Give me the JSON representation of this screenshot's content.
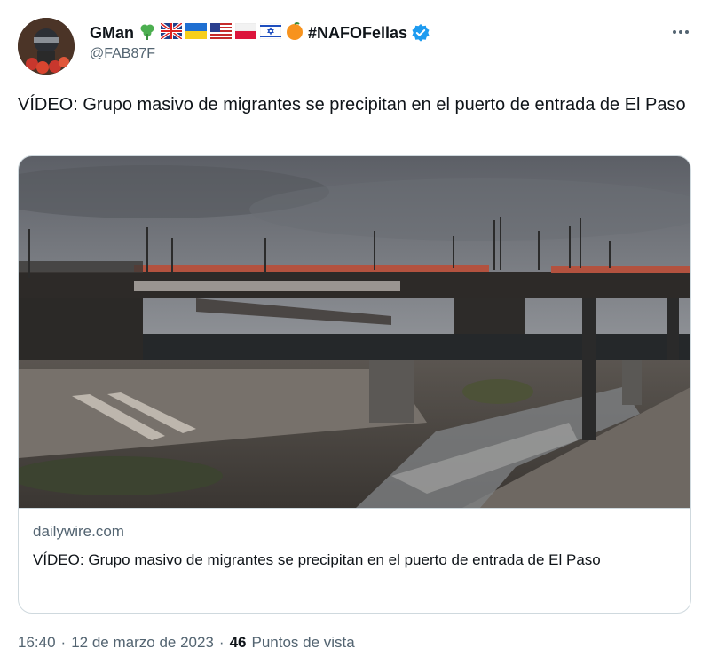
{
  "author": {
    "display_name": "GMan",
    "name_emojis": [
      "☘️",
      "🇬🇧",
      "🇺🇦",
      "🇺🇸",
      "🇵🇱",
      "🇮🇱",
      "🍊"
    ],
    "name_tag": "#NAFOFellas",
    "handle": "@FAB87F",
    "verified": true
  },
  "tweet": {
    "text": "VÍDEO: Grupo masivo de migrantes se precipitan en el puerto de entrada de El Paso"
  },
  "card": {
    "domain": "dailywire.com",
    "title": "VÍDEO: Grupo masivo de migrantes se precipitan en el puerto de entrada de El Paso"
  },
  "meta": {
    "time": "16:40",
    "date": "12 de marzo de 2023",
    "separator": "·",
    "views_count": "46",
    "views_label": "Puntos de vista"
  },
  "colors": {
    "verified": "#1d9bf0",
    "secondary_text": "#536471",
    "border": "#cfd9de"
  }
}
